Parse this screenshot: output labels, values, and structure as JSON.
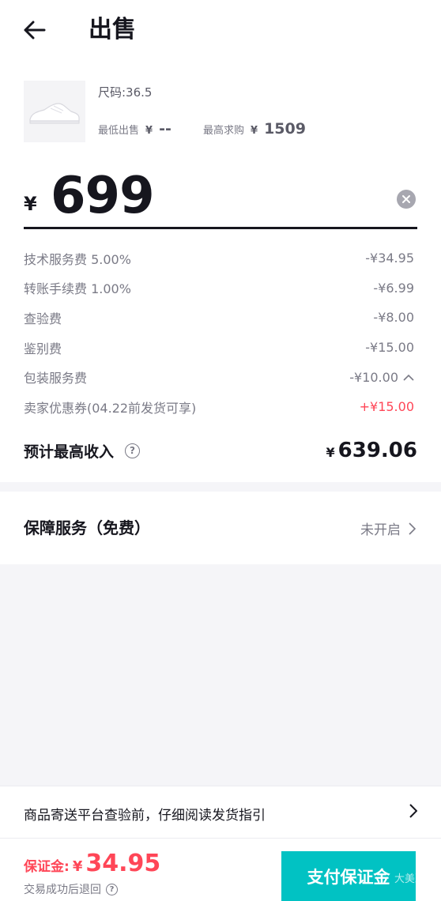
{
  "header": {
    "title": "出售"
  },
  "product": {
    "size": "尺码:36.5",
    "lowest_sell": {
      "label": "最低出售",
      "currency": "¥",
      "value": "--"
    },
    "highest_bid": {
      "label": "最高求购",
      "currency": "¥",
      "value": "1509"
    }
  },
  "price_input": {
    "currency": "¥",
    "value": "699"
  },
  "fees": [
    {
      "label": "技术服务费 5.00%",
      "amount": "-¥34.95"
    },
    {
      "label": "转账手续费 1.00%",
      "amount": "-¥6.99"
    },
    {
      "label": "查验费",
      "amount": "-¥8.00"
    },
    {
      "label": "鉴别费",
      "amount": "-¥15.00"
    },
    {
      "label": "包装服务费",
      "amount": "-¥10.00"
    },
    {
      "label": "卖家优惠券(04.22前发货可享)",
      "amount": "+¥15.00"
    }
  ],
  "income": {
    "label": "预计最高收入",
    "currency": "¥",
    "value": "639.06",
    "help_glyph": "?"
  },
  "guarantee": {
    "label": "保障服务（免费）",
    "status": "未开启"
  },
  "guide": {
    "text": "商品寄送平台查验前，仔细阅读发货指引"
  },
  "footer": {
    "deposit_label": "保证金:",
    "deposit_currency": "¥",
    "deposit_value": "34.95",
    "refund_note": "交易成功后退回",
    "help_glyph": "?",
    "pay_button": "支付保证金",
    "watermark": "大美冷"
  },
  "colors": {
    "accent": "#01c2c3",
    "highlight": "#ff4657",
    "text": "#16161e",
    "muted": "#7a7a86"
  }
}
